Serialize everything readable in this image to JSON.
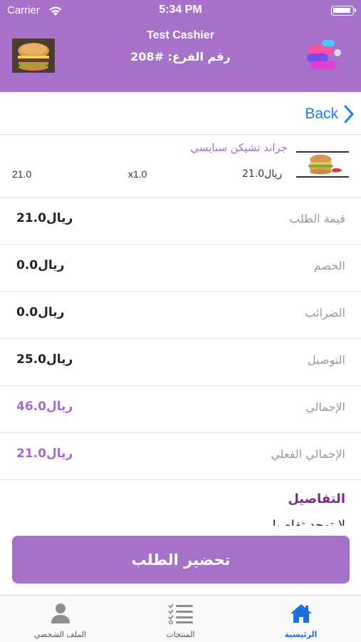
{
  "status_bar": {
    "carrier": "Carrier",
    "time": "5:34 PM"
  },
  "header": {
    "title": "Test Cashier",
    "branch": "رقم الفرع: #208"
  },
  "nav": {
    "back_label": "Back"
  },
  "order_item": {
    "name": "جراند تشيكن سبايسي",
    "unit_price": "21.0ريال",
    "quantity": "x1.0",
    "total": "21.0"
  },
  "summary": [
    {
      "label": "قيمة الطلب",
      "value": "21.0ريال",
      "accent": false
    },
    {
      "label": "الخصم",
      "value": "0.0ريال",
      "accent": false
    },
    {
      "label": "الضرائب",
      "value": "0.0ريال",
      "accent": false
    },
    {
      "label": "التوصيل",
      "value": "25.0ريال",
      "accent": false
    },
    {
      "label": "الإجمالي",
      "value": "46.0ريال",
      "accent": true
    },
    {
      "label": "الإجمالي الفعلي",
      "value": "21.0ريال",
      "accent": true
    }
  ],
  "details": {
    "title": "التفاصيل",
    "text": "لا توجد تفاصيل"
  },
  "actions": {
    "prepare_label": "تحضير الطلب"
  },
  "tab_bar": {
    "items": [
      {
        "label": "الملف الشخصي",
        "icon": "person-icon",
        "active": false
      },
      {
        "label": "المنتجات",
        "icon": "checklist-icon",
        "active": false
      },
      {
        "label": "الرئيسية",
        "icon": "home-icon",
        "active": true
      }
    ]
  },
  "colors": {
    "primary": "#a672c9",
    "accent_text": "#a66bc9",
    "details_title": "#7b2d7c",
    "link": "#1a7ff0",
    "tab_active": "#1a6fd8"
  }
}
